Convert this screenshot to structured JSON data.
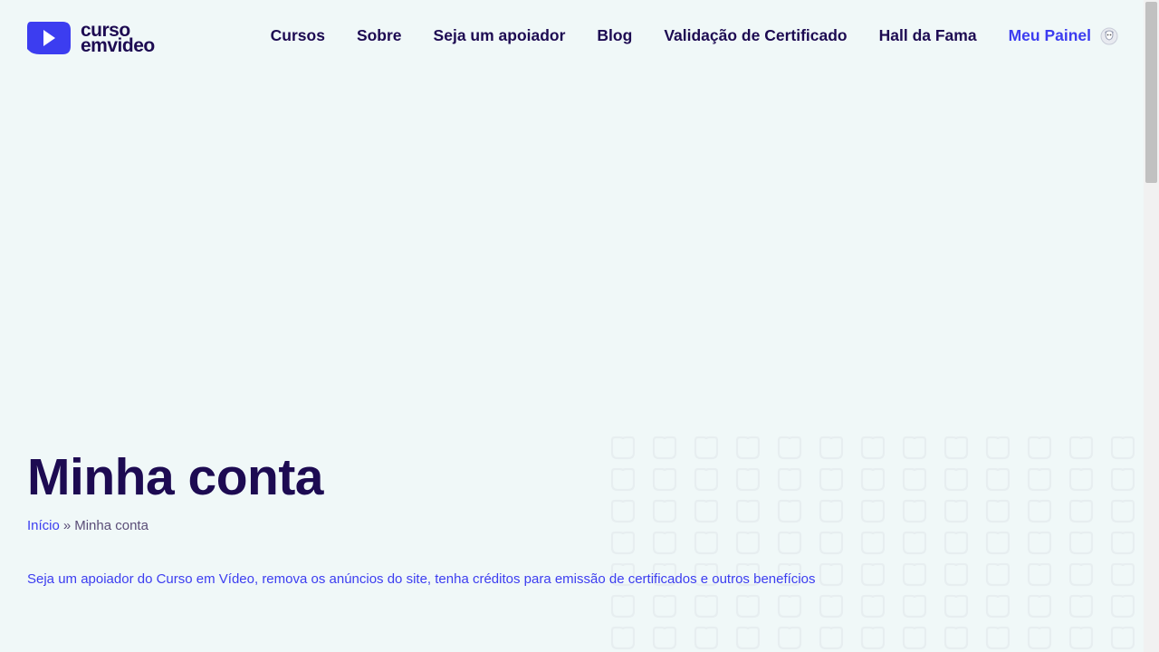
{
  "header": {
    "logo": {
      "line1": "curso",
      "line2": "emvideo",
      "icon": "play-icon"
    },
    "nav": [
      {
        "label": "Cursos"
      },
      {
        "label": "Sobre"
      },
      {
        "label": "Seja um apoiador"
      },
      {
        "label": "Blog"
      },
      {
        "label": "Validação de Certificado"
      },
      {
        "label": "Hall da Fama"
      },
      {
        "label": "Meu Painel",
        "active": true
      }
    ],
    "avatar_icon": "user-avatar-icon"
  },
  "main": {
    "title": "Minha conta",
    "breadcrumb": {
      "home": "Início",
      "separator": "»",
      "current": "Minha conta"
    },
    "promo": "Seja um apoiador do Curso em Vídeo, remova os anúncios do site, tenha créditos para emissão de certificados e outros benefícios"
  },
  "colors": {
    "background": "#f0f8f8",
    "primary_text": "#1d0b52",
    "accent": "#3c3df0"
  }
}
